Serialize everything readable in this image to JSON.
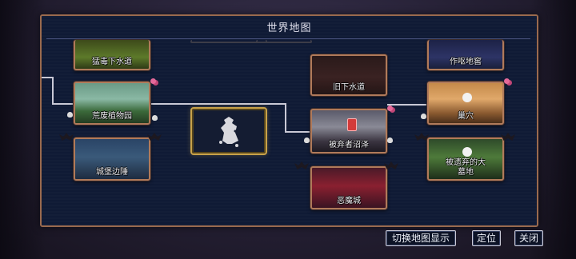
{
  "title": "世界地图",
  "nodes": {
    "toxic_sewers": "猛毒下水道",
    "ossuary": "作呕地窖",
    "old_sewers": "旧下水道",
    "arboretum": "荒废植物园",
    "nest": "巢穴",
    "forgotten_sepulcher": "被弃者沼泽",
    "graveyard": "被遗弃的大墓地",
    "ramparts": "城堡边陲",
    "infested_castle": "恶魔城"
  },
  "buttons": {
    "toggle_map": "切换地图显示",
    "locate": "定位",
    "close": "关闭"
  },
  "colors": {
    "panel_bg": "#0f1a35",
    "frame_gold": "#c8a24a",
    "frame_copper": "#b07a5a"
  }
}
